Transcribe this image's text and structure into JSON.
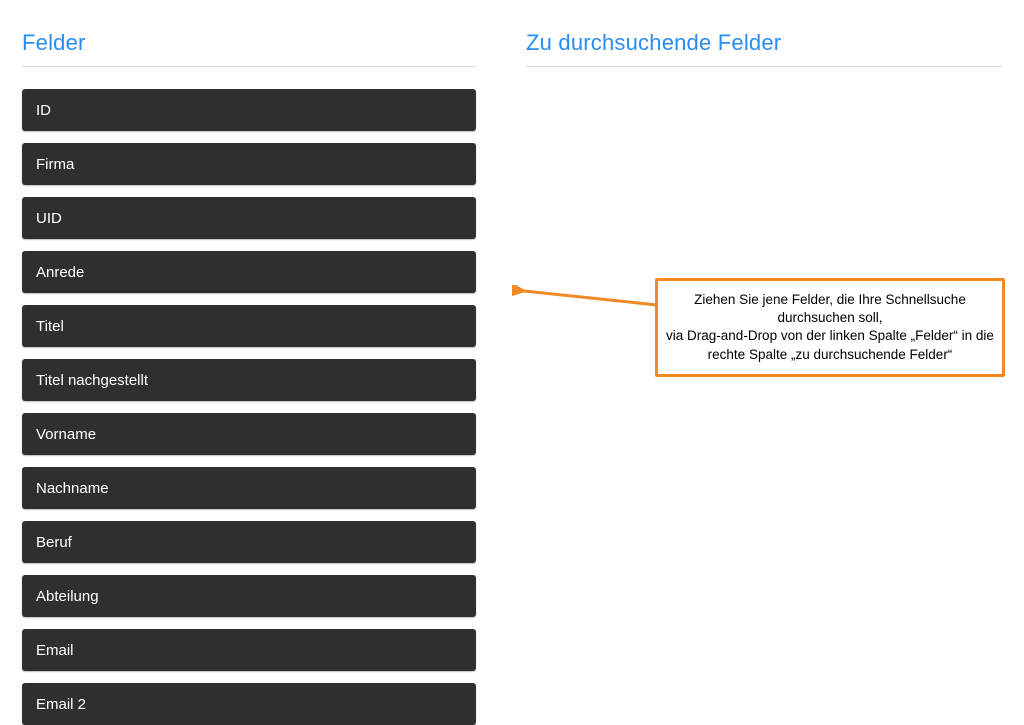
{
  "left": {
    "title": "Felder",
    "fields": [
      "ID",
      "Firma",
      "UID",
      "Anrede",
      "Titel",
      "Titel nachgestellt",
      "Vorname",
      "Nachname",
      "Beruf",
      "Abteilung",
      "Email",
      "Email 2"
    ]
  },
  "right": {
    "title": "Zu durchsuchende Felder"
  },
  "callout": {
    "line1": "Ziehen Sie jene Felder, die Ihre Schnellsuche durchsuchen soll,",
    "line2": "via Drag-and-Drop von der linken Spalte „Felder“ in die rechte Spalte „zu durchsuchende Felder“"
  },
  "colors": {
    "accent_orange": "#f08a24",
    "title_blue": "#2a8cf0",
    "item_bg": "#2f2f2f"
  }
}
